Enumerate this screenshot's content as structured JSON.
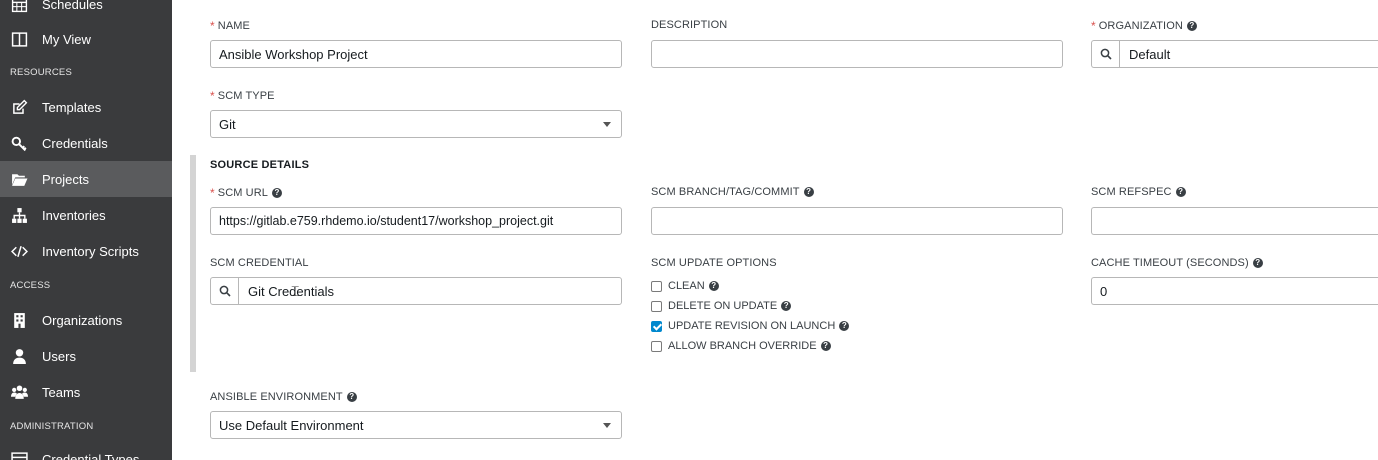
{
  "sidebar": {
    "items": [
      {
        "label": "Schedules",
        "icon": "calendar-icon"
      },
      {
        "label": "My View",
        "icon": "columns-icon"
      },
      {
        "label": "Templates",
        "icon": "edit-icon"
      },
      {
        "label": "Credentials",
        "icon": "key-icon"
      },
      {
        "label": "Projects",
        "icon": "folder-open-icon"
      },
      {
        "label": "Inventories",
        "icon": "sitemap-icon"
      },
      {
        "label": "Inventory Scripts",
        "icon": "code-icon"
      },
      {
        "label": "Organizations",
        "icon": "building-icon"
      },
      {
        "label": "Users",
        "icon": "user-icon"
      },
      {
        "label": "Teams",
        "icon": "users-icon"
      },
      {
        "label": "Credential Types",
        "icon": "list-icon"
      }
    ],
    "sections": [
      "RESOURCES",
      "ACCESS",
      "ADMINISTRATION"
    ],
    "active": "Projects"
  },
  "form": {
    "name_label": "NAME",
    "name_value": "Ansible Workshop Project",
    "description_label": "DESCRIPTION",
    "description_value": "",
    "organization_label": "ORGANIZATION",
    "organization_value": "Default",
    "scm_type_label": "SCM TYPE",
    "scm_type_value": "Git",
    "source_details_title": "SOURCE DETAILS",
    "scm_url_label": "SCM URL",
    "scm_url_value": "https://gitlab.e759.rhdemo.io/student17/workshop_project.git",
    "scm_branch_label": "SCM BRANCH/TAG/COMMIT",
    "scm_branch_value": "",
    "scm_refspec_label": "SCM REFSPEC",
    "scm_refspec_value": "",
    "scm_credential_label": "SCM CREDENTIAL",
    "scm_credential_value": "Git Credentials",
    "scm_update_options_label": "SCM UPDATE OPTIONS",
    "options": [
      {
        "label": "CLEAN",
        "checked": false
      },
      {
        "label": "DELETE ON UPDATE",
        "checked": false
      },
      {
        "label": "UPDATE REVISION ON LAUNCH",
        "checked": true
      },
      {
        "label": "ALLOW BRANCH OVERRIDE",
        "checked": false
      }
    ],
    "cache_timeout_label": "CACHE TIMEOUT (SECONDS)",
    "cache_timeout_value": "0",
    "ansible_env_label": "ANSIBLE ENVIRONMENT",
    "ansible_env_value": "Use Default Environment",
    "required_mark": "*",
    "help_glyph": "?"
  },
  "colors": {
    "sidebar_bg": "#3a3b3d",
    "sidebar_active": "#5a5b5d",
    "required": "#d9534f",
    "checkbox_checked": "#0088ce"
  }
}
